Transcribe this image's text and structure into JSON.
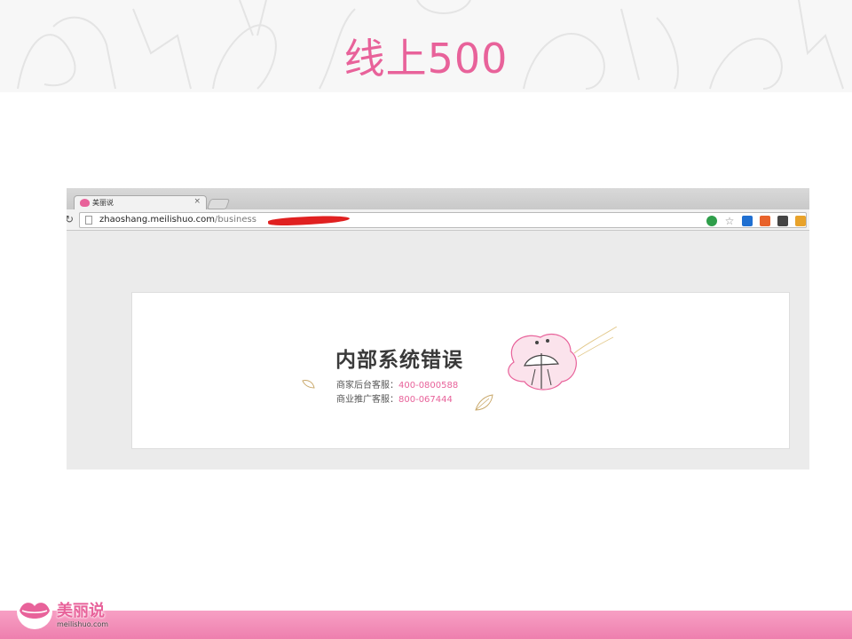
{
  "slide": {
    "title": "线上500"
  },
  "browser": {
    "tab_title": "美丽说",
    "tab_close": "×",
    "url_host": "zhaoshang.meilishuo.com",
    "url_path": "/business",
    "page": {
      "error_title": "内部系统错误",
      "contacts": [
        {
          "label": "商家后台客服：",
          "number": "400-0800588"
        },
        {
          "label": "商业推广客服：",
          "number": "800-067444"
        }
      ]
    }
  },
  "footer": {
    "logo_cn": "美丽说",
    "logo_en": "meilishuo.com"
  },
  "colors": {
    "accent": "#e8629a",
    "footer_bar": "#f28cb7",
    "redaction": "#e02020"
  }
}
